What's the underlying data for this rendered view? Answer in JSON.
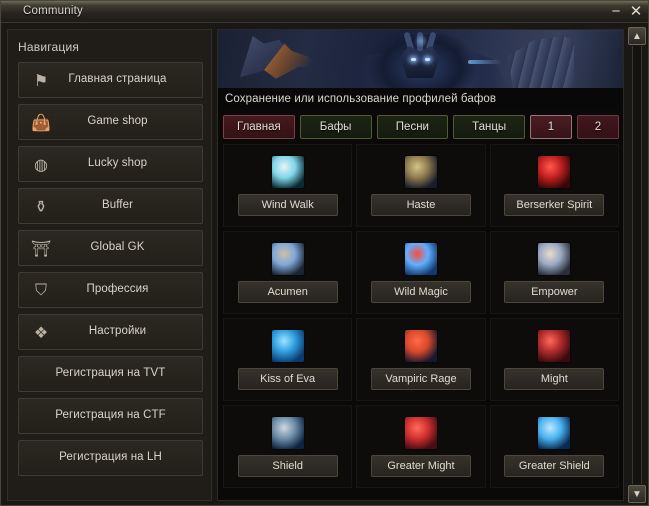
{
  "window": {
    "title": "Community",
    "minimize_label": "−",
    "close_label": "✕"
  },
  "sidebar": {
    "heading": "Навигация",
    "items": [
      {
        "label": "Главная страница",
        "icon": "flag-icon",
        "glyph": "⚑"
      },
      {
        "label": "Game shop",
        "icon": "money-bag-icon",
        "glyph": "👜"
      },
      {
        "label": "Lucky shop",
        "icon": "coin-icon",
        "glyph": "◍"
      },
      {
        "label": "Buffer",
        "icon": "potion-icon",
        "glyph": "⚱"
      },
      {
        "label": "Global GK",
        "icon": "temple-icon",
        "glyph": "⛩"
      },
      {
        "label": "Профессия",
        "icon": "shield-icon",
        "glyph": "⛉"
      },
      {
        "label": "Настройки",
        "icon": "people-icon",
        "glyph": "❖"
      },
      {
        "label": "Регистрация на TVT",
        "icon": "",
        "glyph": ""
      },
      {
        "label": "Регистрация на CTF",
        "icon": "",
        "glyph": ""
      },
      {
        "label": "Регистрация на LH",
        "icon": "",
        "glyph": ""
      }
    ]
  },
  "main": {
    "banner_alt": "fantasy-demon-banner",
    "description": "Сохранение или использование профилей бафов",
    "tabs": [
      {
        "label": "Главная",
        "style": "tab-red",
        "kind": "wide",
        "active": true
      },
      {
        "label": "Бафы",
        "style": "tab-green",
        "kind": "wide",
        "active": false
      },
      {
        "label": "Песни",
        "style": "tab-green",
        "kind": "wide",
        "active": false
      },
      {
        "label": "Танцы",
        "style": "tab-green",
        "kind": "wide",
        "active": false
      },
      {
        "label": "1",
        "style": "tab-num-active",
        "kind": "num",
        "active": true
      },
      {
        "label": "2",
        "style": "tab-num",
        "kind": "num",
        "active": false
      }
    ],
    "buffs": [
      {
        "label": "Wind Walk",
        "icon": "wind-walk-icon",
        "c1": "#e9f2f6",
        "c2": "#0c2a33",
        "c3": "#7fd6e8"
      },
      {
        "label": "Haste",
        "icon": "haste-icon",
        "c1": "#d6c489",
        "c2": "#1a1c2a",
        "c3": "#8d7b4e"
      },
      {
        "label": "Berserker Spirit",
        "icon": "berserker-spirit-icon",
        "c1": "#ff5a4a",
        "c2": "#3a0707",
        "c3": "#c02020"
      },
      {
        "label": "Acumen",
        "icon": "acumen-icon",
        "c1": "#cfc0a8",
        "c2": "#1b2434",
        "c3": "#7fa8d8"
      },
      {
        "label": "Wild Magic",
        "icon": "wild-magic-icon",
        "c1": "#ff4b3a",
        "c2": "#123a6e",
        "c3": "#5fb0ff"
      },
      {
        "label": "Empower",
        "icon": "empower-icon",
        "c1": "#e8dccb",
        "c2": "#2a2f3c",
        "c3": "#9aa8c2"
      },
      {
        "label": "Kiss of Eva",
        "icon": "kiss-of-eva-icon",
        "c1": "#9fe3ff",
        "c2": "#0a3a6e",
        "c3": "#2f9fe0"
      },
      {
        "label": "Vampiric Rage",
        "icon": "vampiric-rage-icon",
        "c1": "#ff6a4a",
        "c2": "#1a1830",
        "c3": "#d84a2a"
      },
      {
        "label": "Might",
        "icon": "might-icon",
        "c1": "#ff6b5a",
        "c2": "#3a0a10",
        "c3": "#b02a2a"
      },
      {
        "label": "Shield",
        "icon": "shield-buff-icon",
        "c1": "#cfd8e0",
        "c2": "#0c2440",
        "c3": "#6f8ea8"
      },
      {
        "label": "Greater Might",
        "icon": "greater-might-icon",
        "c1": "#ff6b5a",
        "c2": "#4a0c10",
        "c3": "#d03030"
      },
      {
        "label": "Greater Shield",
        "icon": "greater-shield-icon",
        "c1": "#bfe6ff",
        "c2": "#0a2a52",
        "c3": "#49b3f0"
      }
    ]
  },
  "scrollbar": {
    "up_label": "▲",
    "down_label": "▼"
  },
  "colors": {
    "accent_red": "#7b4046",
    "accent_green": "#4e5b34",
    "window_bg": "#1a1815",
    "panel_bg": "#0a0908"
  }
}
